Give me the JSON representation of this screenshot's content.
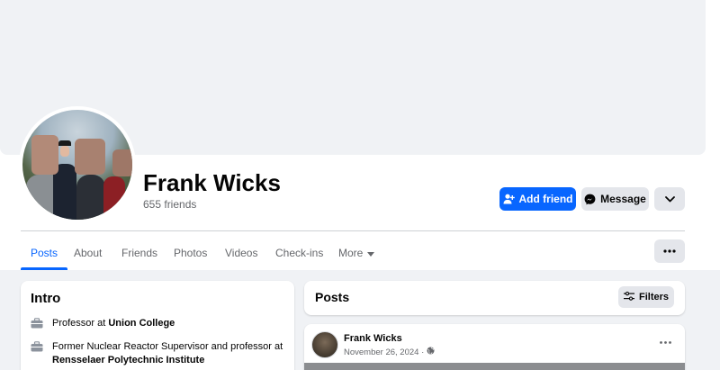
{
  "profile": {
    "name": "Frank Wicks",
    "friends_count": "655 friends"
  },
  "actions": {
    "add_friend": "Add friend",
    "message": "Message"
  },
  "tabs": [
    {
      "label": "Posts",
      "active": true
    },
    {
      "label": "About"
    },
    {
      "label": "Friends"
    },
    {
      "label": "Photos"
    },
    {
      "label": "Videos"
    },
    {
      "label": "Check-ins"
    },
    {
      "label": "More"
    }
  ],
  "intro": {
    "title": "Intro",
    "items": [
      {
        "icon": "briefcase-icon",
        "prefix": "Professor at ",
        "emphasis": "Union College"
      },
      {
        "icon": "briefcase-icon",
        "prefix": "Former Nuclear Reactor Supervisor and professor at ",
        "emphasis": "Rensselaer Polytechnic Institute"
      }
    ]
  },
  "posts": {
    "title": "Posts",
    "filters_label": "Filters"
  },
  "post": {
    "author": "Frank Wicks",
    "date": "November 26, 2024 ·",
    "privacy_icon": "globe-icon"
  },
  "colors": {
    "primary": "#0866ff",
    "secondary_button": "#e4e6eb",
    "page_background": "#f0f2f5",
    "muted_text": "#65676b"
  }
}
